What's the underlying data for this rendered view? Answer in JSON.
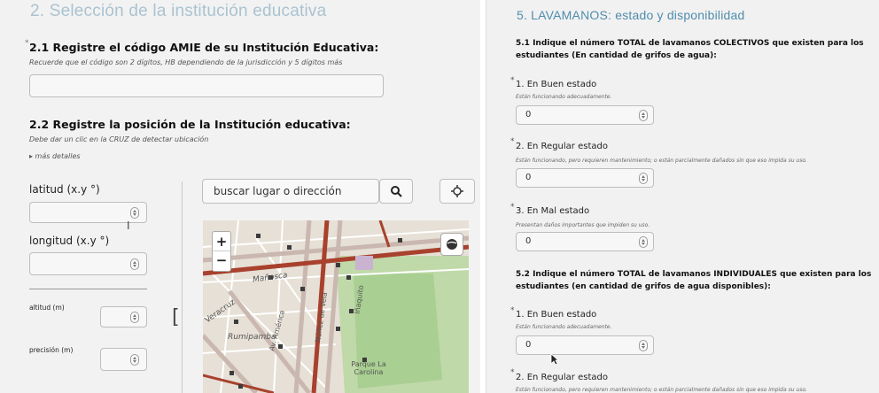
{
  "left": {
    "section_title": "2. Selección de la institución educativa",
    "q21": {
      "title": "2.1 Registre el código AMIE de su Institución Educativa:",
      "hint": "Recuerde que el código son 2 dígitos, HB dependiendo de la jurisdicción y 5 dígitos más",
      "value": ""
    },
    "q22": {
      "title": "2.2 Registre la posición de la Institución educativa:",
      "hint": "Debe dar un clic en la CRUZ de detectar ubicación",
      "details": "▸ más detalles"
    },
    "lat_label": "latitud (x.y °)",
    "lon_label": "longitud (x.y °)",
    "alt_label": "altitud (m)",
    "prec_label": "precisión (m)",
    "search_placeholder": "buscar lugar o dirección",
    "map": {
      "zoom_in": "+",
      "zoom_out": "−",
      "labels": [
        "Mañosca",
        "Veracruz",
        "Rumipamba",
        "Núñez de Vela",
        "Iñaquito",
        "Av. América",
        "Parque La Carolina"
      ]
    }
  },
  "right": {
    "section_title": "5. LAVAMANOS: estado y disponibilidad",
    "q51": {
      "title": "5.1 Indique el número TOTAL de lavamanos COLECTIVOS que existen para los estudiantes (En cantidad de grifos de agua):",
      "items": [
        {
          "label": "1. En Buen estado",
          "hint": "Están funcionando adecuadamente.",
          "value": "0"
        },
        {
          "label": "2. En Regular estado",
          "hint": "Están funcionando, pero requieren mantenimiento; o están parcialmente dañados sin que eso impida su uso.",
          "value": "0"
        },
        {
          "label": "3. En Mal estado",
          "hint": "Presentan daños importantes que impiden su uso.",
          "value": "0"
        }
      ]
    },
    "q52": {
      "title": "5.2 Indique el número TOTAL de lavamanos INDIVIDUALES que existen para los estudiantes (en cantidad de grifos de agua disponibles):",
      "items": [
        {
          "label": "1. En Buen estado",
          "hint": "Están funcionando adecuadamente.",
          "value": "0"
        },
        {
          "label": "2. En Regular estado",
          "hint": "Están funcionando, pero requieren mantenimiento; o están parcialmente dañados sin que eso impida su uso."
        }
      ]
    }
  }
}
